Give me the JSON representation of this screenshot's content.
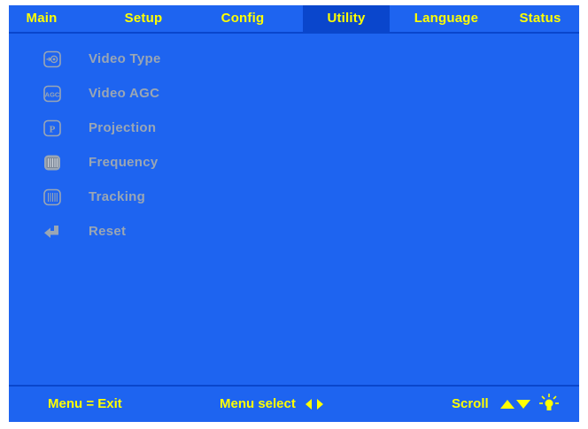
{
  "tabs": [
    {
      "label": "Main",
      "active": false
    },
    {
      "label": "Setup",
      "active": false
    },
    {
      "label": "Config",
      "active": false
    },
    {
      "label": "Utility",
      "active": true
    },
    {
      "label": "Language",
      "active": false
    },
    {
      "label": "Status",
      "active": false
    }
  ],
  "menu": {
    "items": [
      {
        "label": "Video Type",
        "icon": "video-type-icon"
      },
      {
        "label": "Video AGC",
        "icon": "agc-icon",
        "icon_text": "AGC"
      },
      {
        "label": "Projection",
        "icon": "projection-icon",
        "icon_text": "P"
      },
      {
        "label": "Frequency",
        "icon": "frequency-icon"
      },
      {
        "label": "Tracking",
        "icon": "tracking-icon"
      },
      {
        "label": "Reset",
        "icon": "reset-arrow-icon"
      }
    ]
  },
  "footer": {
    "exit_hint": "Menu = Exit",
    "select_hint": "Menu select",
    "scroll_hint": "Scroll"
  },
  "colors": {
    "background": "#1e64f0",
    "active_tab": "#0a46cc",
    "text_active": "#ffff00",
    "text_disabled": "#9aa6b4"
  }
}
